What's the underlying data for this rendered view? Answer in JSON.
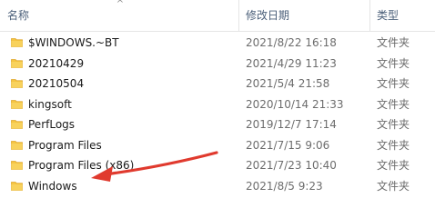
{
  "header": {
    "name": "名称",
    "date": "修改日期",
    "type": "类型",
    "sort_indicator": "^"
  },
  "rows": [
    {
      "name": "$WINDOWS.~BT",
      "date": "2021/8/22 16:18",
      "type": "文件夹"
    },
    {
      "name": "20210429",
      "date": "2021/4/29 11:23",
      "type": "文件夹"
    },
    {
      "name": "20210504",
      "date": "2021/5/4 21:58",
      "type": "文件夹"
    },
    {
      "name": "kingsoft",
      "date": "2020/10/14 21:33",
      "type": "文件夹"
    },
    {
      "name": "PerfLogs",
      "date": "2019/12/7 17:14",
      "type": "文件夹"
    },
    {
      "name": "Program Files",
      "date": "2021/7/15 9:06",
      "type": "文件夹"
    },
    {
      "name": "Program Files (x86)",
      "date": "2021/7/23 10:40",
      "type": "文件夹"
    },
    {
      "name": "Windows",
      "date": "2021/8/5 9:23",
      "type": "文件夹"
    }
  ],
  "colors": {
    "folder": "#f5c542",
    "folder_dark": "#e0a82e",
    "annotation_arrow": "#e03a2e",
    "header_text": "#4c607a"
  },
  "icons": {
    "row_icon": "folder-icon"
  }
}
